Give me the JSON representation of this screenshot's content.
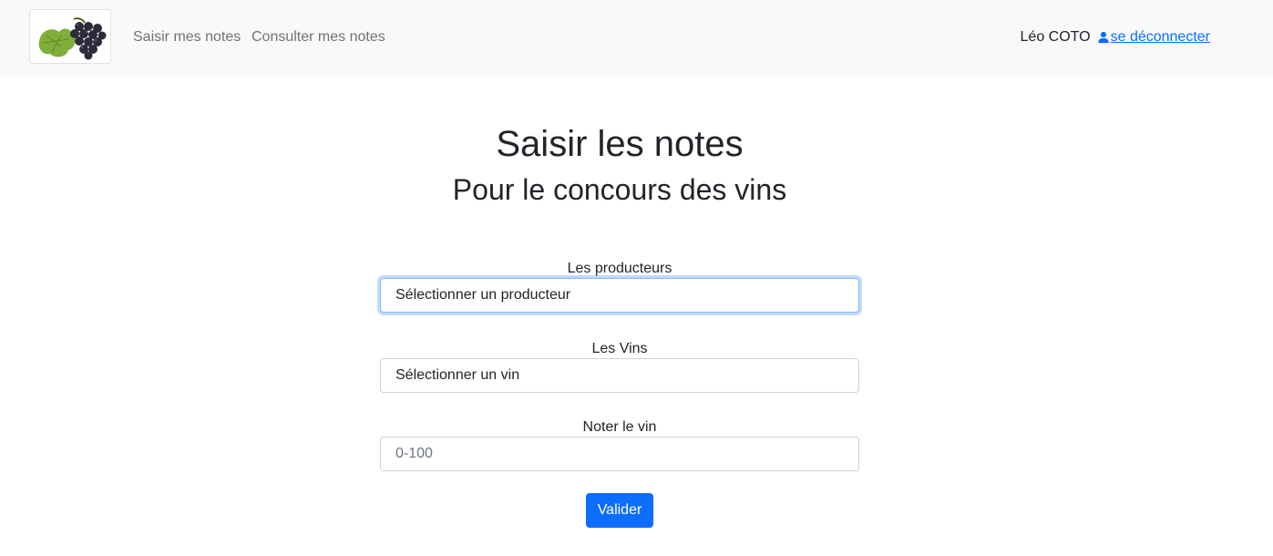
{
  "navbar": {
    "logo_icon": "grapes-logo-icon",
    "links": [
      "Saisir mes notes",
      "Consulter mes notes"
    ],
    "user_name": "Léo COTO",
    "user_icon": "person-icon",
    "logout_label": "se déconnecter",
    "link_color": "#0d6efd"
  },
  "main": {
    "title": "Saisir les notes",
    "subtitle": "Pour le concours des vins",
    "producers": {
      "label": "Les producteurs",
      "selected": "Sélectionner un producteur"
    },
    "wines": {
      "label": "Les Vins",
      "selected": "Sélectionner un vin"
    },
    "rating": {
      "label": "Noter le vin",
      "placeholder": "0-100"
    },
    "submit_label": "Valider",
    "accent_color": "#0d6efd"
  }
}
